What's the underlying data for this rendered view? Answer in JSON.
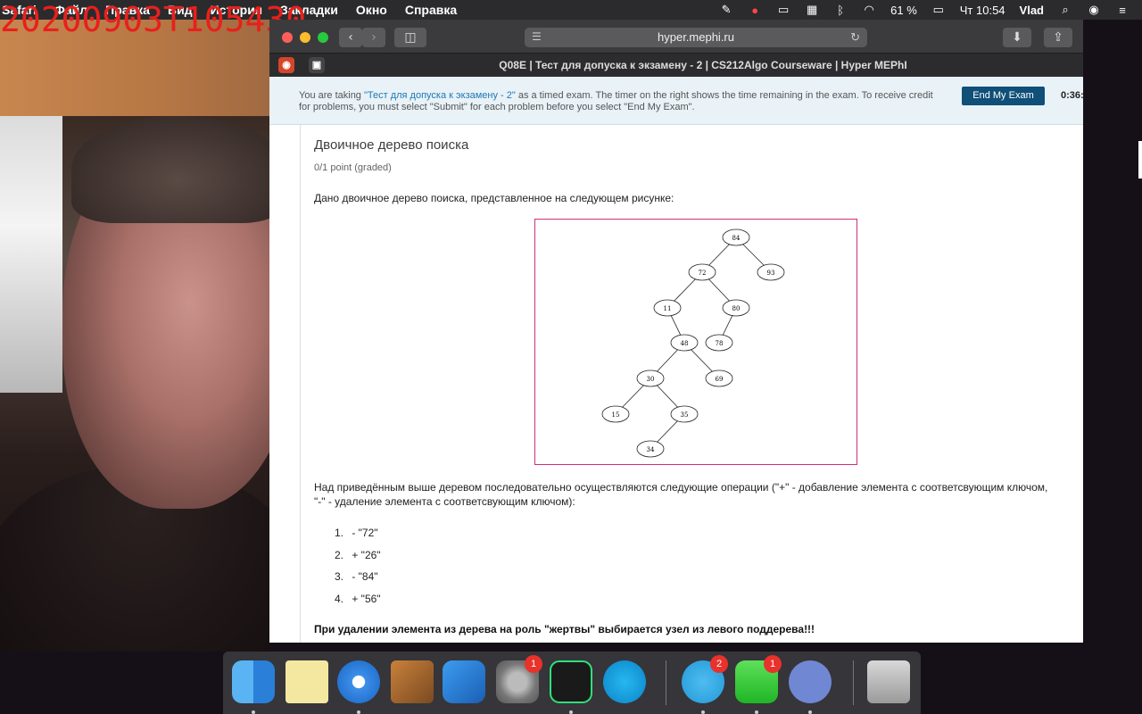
{
  "menubar": {
    "app": "Safari",
    "items": [
      "Файл",
      "Правка",
      "Вид",
      "История",
      "Закладки",
      "Окно",
      "Справка"
    ],
    "battery": "61 %",
    "clock": "Чт 10:54",
    "user": "Vlad"
  },
  "watermark": "20200903T105430",
  "browser": {
    "url": "hyper.mephi.ru",
    "tab_title": "Q08E | Тест для допуска к экзамену - 2 | CS212Algo Courseware | Hyper MEPhI"
  },
  "banner": {
    "prefix": "You are taking ",
    "exam_link": "\"Тест для допуска к экзамену - 2\"",
    "suffix": " as a timed exam. The timer on the right shows the time remaining in the exam. To receive credit for problems, you must select \"Submit\" for each problem before you select \"End My Exam\".",
    "end_button": "End My Exam",
    "timer": "0:36:"
  },
  "problem": {
    "title": "Двоичное дерево поиска",
    "points": "0/1 point (graded)",
    "intro": "Дано двоичное дерево поиска, представленное на следующем рисунке:",
    "desc": "Над приведённым выше деревом последовательно осуществляются следующие операции (\"+\" - добавление элемента с соответсвующим ключом, \"-\" - удаление элемента с соответсвующим ключом):",
    "operations": [
      {
        "num": "1.",
        "text": "- \"72\""
      },
      {
        "num": "2.",
        "text": "+ \"26\""
      },
      {
        "num": "3.",
        "text": "- \"84\""
      },
      {
        "num": "4.",
        "text": "+ \"56\""
      }
    ],
    "warning": "При удалении элемента из дерева на роль \"жертвы\" выбирается узел из левого поддерева!!!"
  },
  "tree": {
    "nodes": [
      "84",
      "72",
      "93",
      "11",
      "80",
      "48",
      "78",
      "30",
      "69",
      "15",
      "35",
      "34"
    ],
    "edges": [
      [
        "84",
        "72"
      ],
      [
        "84",
        "93"
      ],
      [
        "72",
        "11"
      ],
      [
        "72",
        "80"
      ],
      [
        "11",
        "48"
      ],
      [
        "80",
        "78"
      ],
      [
        "48",
        "30"
      ],
      [
        "48",
        "69"
      ],
      [
        "30",
        "15"
      ],
      [
        "30",
        "35"
      ],
      [
        "35",
        "34"
      ]
    ]
  },
  "dock": {
    "badges": {
      "system_preferences": "1",
      "telegram": "2",
      "messages": "1"
    }
  }
}
